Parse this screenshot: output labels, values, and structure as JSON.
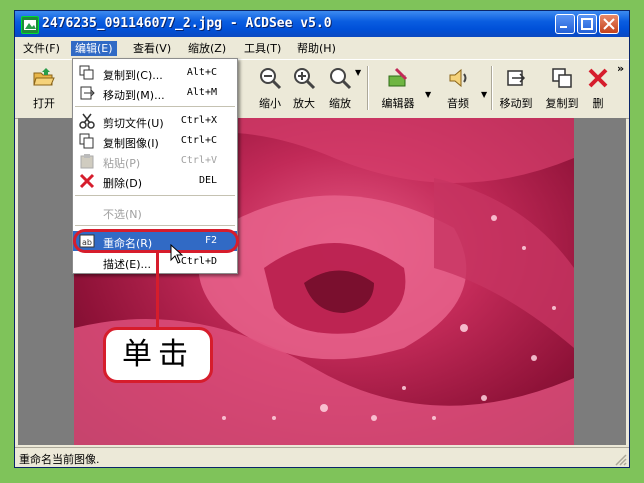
{
  "window": {
    "title": "2476235_091146077_2.jpg - ACDSee v5.0"
  },
  "menubar": {
    "items": [
      {
        "label": "文件(F)"
      },
      {
        "label": "编辑(E)"
      },
      {
        "label": "查看(V)"
      },
      {
        "label": "缩放(Z)"
      },
      {
        "label": "工具(T)"
      },
      {
        "label": "帮助(H)"
      }
    ]
  },
  "toolbar": {
    "tools": [
      {
        "label": "打开",
        "icon": "open-folder-icon"
      },
      {
        "label": "缩小",
        "icon": "zoom-out-icon"
      },
      {
        "label": "放大",
        "icon": "zoom-in-icon"
      },
      {
        "label": "缩放",
        "icon": "zoom-icon"
      },
      {
        "label": "编辑器",
        "icon": "editor-icon"
      },
      {
        "label": "音频",
        "icon": "speaker-icon"
      },
      {
        "label": "移动到",
        "icon": "move-to-icon"
      },
      {
        "label": "复制到",
        "icon": "copy-to-icon"
      },
      {
        "label": "删",
        "icon": "delete-icon"
      }
    ],
    "overflow": "»"
  },
  "edit_menu": {
    "items": [
      {
        "label": "复制到(C)...",
        "shortcut": "Alt+C"
      },
      {
        "label": "移动到(M)...",
        "shortcut": "Alt+M"
      },
      {
        "label": "剪切文件(U)",
        "shortcut": "Ctrl+X"
      },
      {
        "label": "复制图像(I)",
        "shortcut": "Ctrl+C"
      },
      {
        "label": "粘贴(P)",
        "shortcut": "Ctrl+V"
      },
      {
        "label": "删除(D)",
        "shortcut": "DEL"
      },
      {
        "label": "不选(N)",
        "shortcut": ""
      },
      {
        "label": "重命名(R)",
        "shortcut": "F2"
      },
      {
        "label": "描述(E)...",
        "shortcut": "Ctrl+D"
      }
    ]
  },
  "callout": {
    "text": "单击"
  },
  "statusbar": {
    "text": "重命名当前图像."
  },
  "colors": {
    "accent": "#316ac5",
    "callout": "#d61d2c"
  }
}
